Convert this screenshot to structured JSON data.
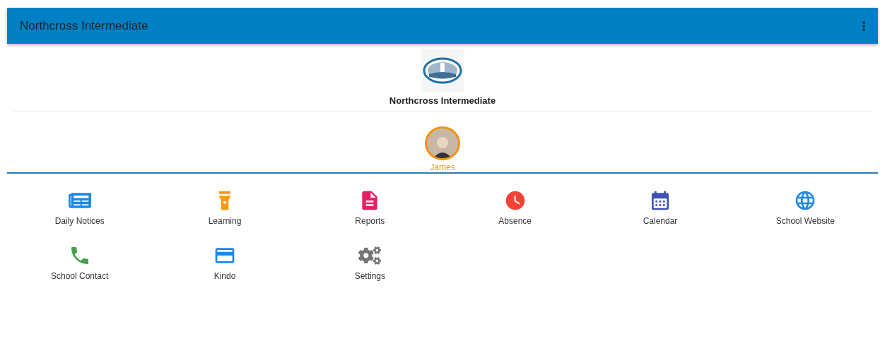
{
  "app_bar": {
    "title": "Northcross Intermediate"
  },
  "school": {
    "name": "Northcross Intermediate"
  },
  "student": {
    "name": "James"
  },
  "tiles": [
    {
      "kind": "notices",
      "label": "Daily Notices",
      "color": "#1e88e5"
    },
    {
      "kind": "learning",
      "label": "Learning",
      "color": "#f39c12"
    },
    {
      "kind": "reports",
      "label": "Reports",
      "color": "#e91e63"
    },
    {
      "kind": "absence",
      "label": "Absence",
      "color": "#f44336"
    },
    {
      "kind": "calendar",
      "label": "Calendar",
      "color": "#3f51b5"
    },
    {
      "kind": "website",
      "label": "School Website",
      "color": "#1e88e5"
    },
    {
      "kind": "contact",
      "label": "School Contact",
      "color": "#43a047"
    },
    {
      "kind": "kindo",
      "label": "Kindo",
      "color": "#1e88e5"
    },
    {
      "kind": "settings",
      "label": "Settings",
      "color": "#757575"
    }
  ]
}
